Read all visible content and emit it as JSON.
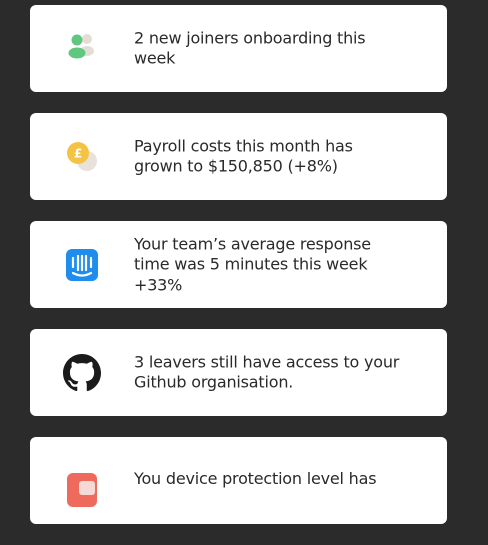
{
  "notifications": [
    {
      "icon": "people-icon",
      "text": "2 new joiners onboarding this week"
    },
    {
      "icon": "pound-coin-icon",
      "text": "Payroll costs this month has grown to $150,850 (+8%)"
    },
    {
      "icon": "intercom-icon",
      "text": "Your team’s average response time was 5 minutes this week +33%"
    },
    {
      "icon": "github-icon",
      "text": "3 leavers still have access to your Github organisation."
    },
    {
      "icon": "device-protection-icon",
      "text": "You device protection level has"
    }
  ],
  "colors": {
    "background": "#2b2b2b",
    "card": "#ffffff",
    "text": "#2a2a2a",
    "people_green": "#5fc77e",
    "coin_yellow": "#f5c343",
    "intercom_blue": "#1f8ded",
    "github_black": "#1b1b1b",
    "device_red": "#ee6a5c"
  }
}
